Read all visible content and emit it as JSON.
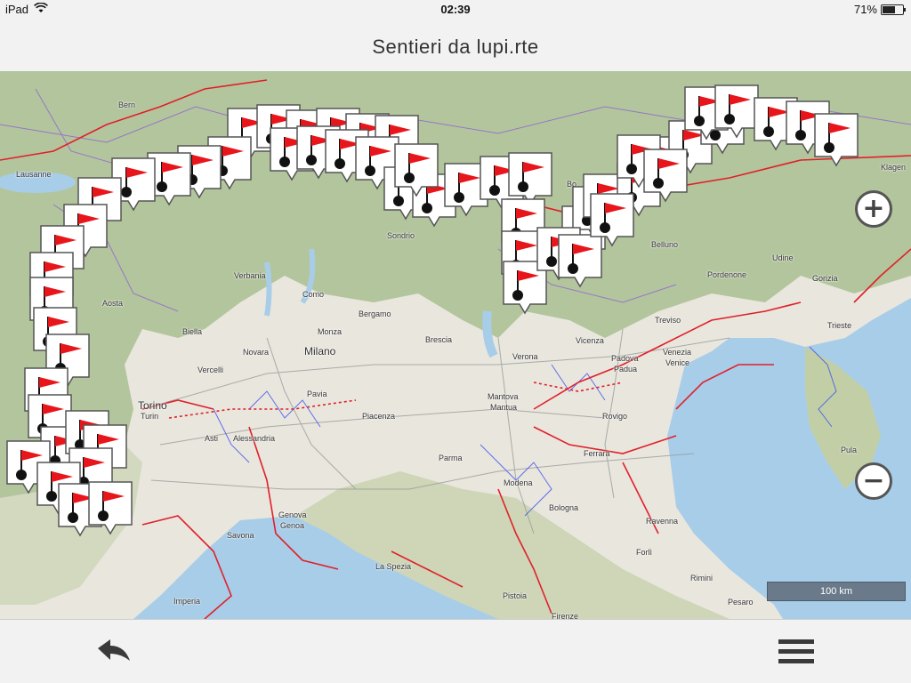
{
  "status_bar": {
    "device": "iPad",
    "time": "02:39",
    "battery": "71%",
    "battery_level": 0.71,
    "wifi_icon": "wifi-icon"
  },
  "header": {
    "title": "Sentieri  da  lupi.rte"
  },
  "map": {
    "places": [
      {
        "key": "bern",
        "name": "Bern"
      },
      {
        "key": "lausanne",
        "name": "Lausanne"
      },
      {
        "key": "aosta",
        "name": "Aosta"
      },
      {
        "key": "biella",
        "name": "Biella"
      },
      {
        "key": "verbania",
        "name": "Verbania"
      },
      {
        "key": "como",
        "name": "Como"
      },
      {
        "key": "bergamo",
        "name": "Bergamo"
      },
      {
        "key": "monza",
        "name": "Monza"
      },
      {
        "key": "milano",
        "name": "Milano"
      },
      {
        "key": "novara",
        "name": "Novara"
      },
      {
        "key": "vercelli",
        "name": "Vercelli"
      },
      {
        "key": "brescia",
        "name": "Brescia"
      },
      {
        "key": "sondrio",
        "name": "Sondrio"
      },
      {
        "key": "torino",
        "name": "Torino"
      },
      {
        "key": "turin",
        "name": "Turin"
      },
      {
        "key": "asti",
        "name": "Asti"
      },
      {
        "key": "alessandria",
        "name": "Alessandria"
      },
      {
        "key": "pavia",
        "name": "Pavia"
      },
      {
        "key": "piacenza",
        "name": "Piacenza"
      },
      {
        "key": "verona",
        "name": "Verona"
      },
      {
        "key": "vicenza",
        "name": "Vicenza"
      },
      {
        "key": "padova",
        "name": "Padova"
      },
      {
        "key": "padua",
        "name": "Padua"
      },
      {
        "key": "venezia",
        "name": "Venezia"
      },
      {
        "key": "venice",
        "name": "Venice"
      },
      {
        "key": "treviso",
        "name": "Treviso"
      },
      {
        "key": "belluno",
        "name": "Belluno"
      },
      {
        "key": "pordenone",
        "name": "Pordenone"
      },
      {
        "key": "udine",
        "name": "Udine"
      },
      {
        "key": "gorizia",
        "name": "Gorizia"
      },
      {
        "key": "trieste",
        "name": "Trieste"
      },
      {
        "key": "klagenfurt",
        "name": "Klagen"
      },
      {
        "key": "pula",
        "name": "Pula"
      },
      {
        "key": "mantova",
        "name": "Mantova"
      },
      {
        "key": "mantua",
        "name": "Mantua"
      },
      {
        "key": "rovigo",
        "name": "Rovigo"
      },
      {
        "key": "parma",
        "name": "Parma"
      },
      {
        "key": "modena",
        "name": "Modena"
      },
      {
        "key": "bologna",
        "name": "Bologna"
      },
      {
        "key": "ferrara",
        "name": "Ferrara"
      },
      {
        "key": "ravenna",
        "name": "Ravenna"
      },
      {
        "key": "forli",
        "name": "Forlì"
      },
      {
        "key": "rimini",
        "name": "Rimini"
      },
      {
        "key": "pesaro",
        "name": "Pesaro"
      },
      {
        "key": "genova",
        "name": "Genova"
      },
      {
        "key": "genoa",
        "name": "Genoa"
      },
      {
        "key": "savona",
        "name": "Savona"
      },
      {
        "key": "laspezia",
        "name": "La Spezia"
      },
      {
        "key": "imperia",
        "name": "Imperia"
      },
      {
        "key": "pistoia",
        "name": "Pistoia"
      },
      {
        "key": "firenze",
        "name": "Firenze"
      },
      {
        "key": "bo",
        "name": "Bo"
      }
    ],
    "scale_label": "100 km",
    "marker_icon": "start-flag-marker-icon",
    "colors": {
      "land": "#e9e6dd",
      "sea": "#a8cde8",
      "alps": "#a9be92",
      "route_red": "#e0202a",
      "route_purple": "#8a55d8",
      "route_blue": "#3a4ff0",
      "flag_red": "#e8151b"
    }
  },
  "controls": {
    "zoom_in_icon": "plus-icon",
    "zoom_in_label": "+",
    "zoom_out_icon": "minus-icon",
    "zoom_out_label": "−"
  },
  "bottom_bar": {
    "back_icon": "back-arrow-icon",
    "menu_icon": "hamburger-menu-icon"
  }
}
